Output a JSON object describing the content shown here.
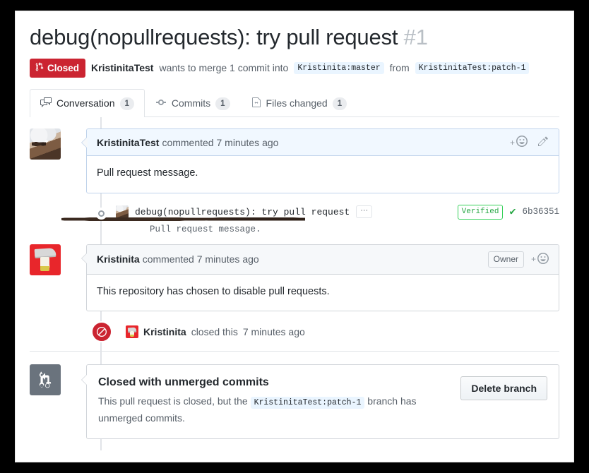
{
  "header": {
    "title": "debug(nopullrequests): try pull request",
    "number": "#1",
    "state_label": "Closed",
    "state_color": "#cb2431",
    "author": "KristinitaTest",
    "merge_text_1": "wants to merge 1 commit into",
    "base_branch": "Kristinita:master",
    "merge_text_2": "from",
    "head_branch": "KristinitaTest:patch-1"
  },
  "tabs": [
    {
      "label": "Conversation",
      "count": "1",
      "icon": "comment-discussion-icon",
      "selected": true
    },
    {
      "label": "Commits",
      "count": "1",
      "icon": "git-commit-icon",
      "selected": false
    },
    {
      "label": "Files changed",
      "count": "1",
      "icon": "file-diff-icon",
      "selected": false
    }
  ],
  "comments": [
    {
      "user": "KristinitaTest",
      "action": "commented",
      "time": "7 minutes ago",
      "body": "Pull request message.",
      "is_author": true,
      "badge": "",
      "reaction_label": "+",
      "has_edit": true
    },
    {
      "user": "Kristinita",
      "action": "commented",
      "time": "7 minutes ago",
      "body": "This repository has chosen to disable pull requests.",
      "is_author": false,
      "badge": "Owner",
      "reaction_label": "+",
      "has_edit": false
    }
  ],
  "commit": {
    "message": "debug(nopullrequests): try pull request",
    "ellipsis_label": "···",
    "body": "Pull request message.",
    "verified_label": "Verified",
    "check_glyph": "✔",
    "sha": "6b36351"
  },
  "closed_event": {
    "user": "Kristinita",
    "text": "closed this",
    "time": "7 minutes ago",
    "icon": "circle-slash-icon",
    "badge_color": "#cb2431"
  },
  "merge_box": {
    "icon": "git-pull-request-icon",
    "title": "Closed with unmerged commits",
    "desc_before": "This pull request is closed, but the",
    "branch": "KristinitaTest:patch-1",
    "desc_after": "branch has unmerged commits.",
    "button_label": "Delete branch"
  }
}
